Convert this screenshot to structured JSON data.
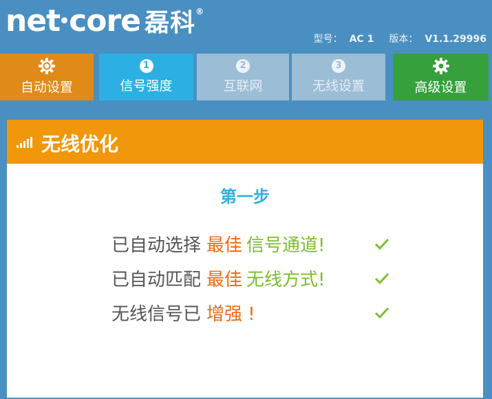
{
  "header": {
    "logo_en_left": "net",
    "logo_en_right": "core",
    "logo_cn": "磊科",
    "registered": "®",
    "model_label": "型号：",
    "model_value": "AC 1",
    "version_label": "版本：",
    "version_value": "V1.1.29996"
  },
  "nav": {
    "items": [
      {
        "label": "自动设置",
        "icon": "gear-refresh-icon",
        "color": "#e08a1a"
      },
      {
        "label": "信号强度",
        "number": "1",
        "color": "#2cb0e3"
      },
      {
        "label": "互联网",
        "number": "2",
        "color": "#9cbdd6"
      },
      {
        "label": "无线设置",
        "number": "3",
        "color": "#9cbdd6"
      },
      {
        "label": "高级设置",
        "icon": "gear-icon",
        "color": "#35a03c"
      }
    ]
  },
  "panel": {
    "title": "无线优化",
    "title_icon": "signal-bars-icon",
    "step": "第一步",
    "rows": [
      {
        "prefix": "已自动选择",
        "highlight": "最佳",
        "suffix": "信号通道!"
      },
      {
        "prefix": "已自动匹配",
        "highlight": "最佳",
        "suffix": "无线方式!"
      },
      {
        "prefix": "无线信号已",
        "highlight": "增强 !",
        "suffix": ""
      }
    ]
  },
  "colors": {
    "brand_blue": "#4a8fc1",
    "orange": "#f0970b",
    "highlight_orange": "#f06a0b",
    "ok_green": "#7bbd2d",
    "step_blue": "#2cb0e3"
  }
}
